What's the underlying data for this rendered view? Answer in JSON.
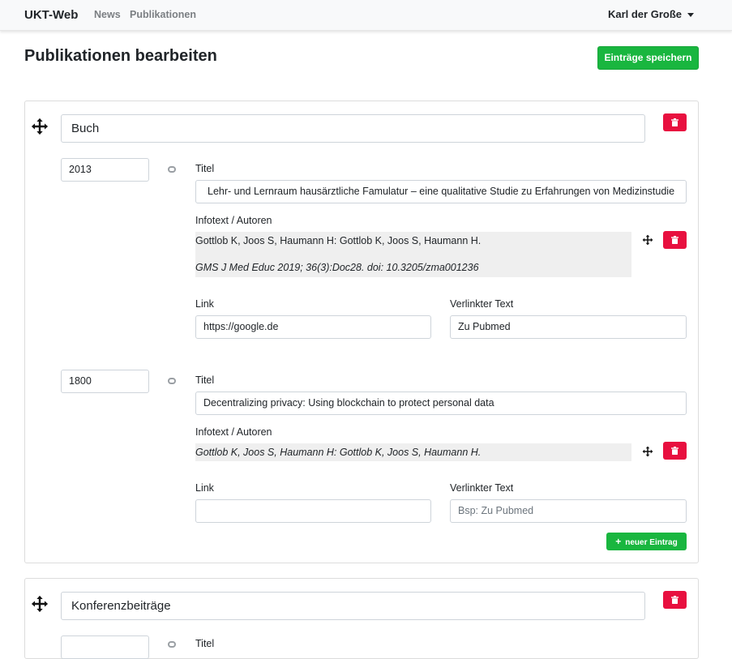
{
  "navbar": {
    "brand": "UKT-Web",
    "links": [
      "News",
      "Publikationen"
    ],
    "user": "Karl der Große"
  },
  "page": {
    "title": "Publikationen bearbeiten",
    "save_label": "Einträge speichern"
  },
  "labels": {
    "title": "Titel",
    "info": "Infotext / Autoren",
    "link": "Link",
    "linked_text": "Verlinkter Text",
    "new_entry": "neuer Eintrag",
    "linked_text_placeholder": "Bsp: Zu Pubmed"
  },
  "categories": [
    {
      "name": "Buch",
      "entries": [
        {
          "year": "2013",
          "title": "Lehr- und Lernraum hausärztliche Famulatur – eine qualitative Studie zu Erfahrungen von Medizinstudie",
          "info_line1": "Gottlob K, Joos S, Haumann H: Gottlob K, Joos S, Haumann H.",
          "info_line2": "GMS J Med Educ 2019; 36(3):Doc28. doi: 10.3205/zma001236",
          "link": "https://google.de",
          "linked_text": "Zu Pubmed"
        },
        {
          "year": "1800",
          "title": "Decentralizing privacy: Using blockchain to protect personal data",
          "info_line1": "Gottlob K, Joos S, Haumann H: Gottlob K, Joos S, Haumann H.",
          "link": "",
          "linked_text": ""
        }
      ]
    },
    {
      "name": "Konferenzbeiträge"
    }
  ],
  "colors": {
    "success": "#19b63f",
    "danger": "#e8103f",
    "navbar_bg": "#f8f9fa"
  }
}
